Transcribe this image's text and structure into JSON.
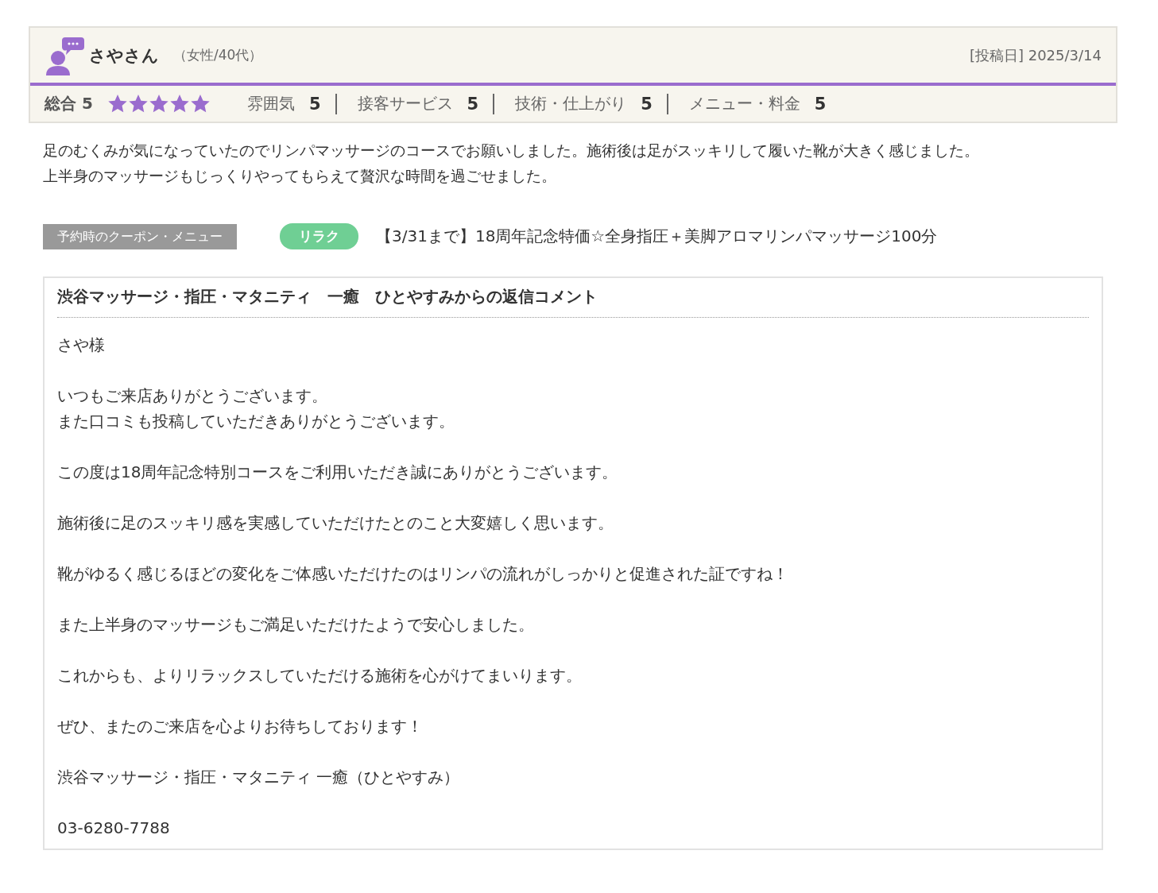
{
  "review": {
    "reviewer": "さやさん",
    "profile": "（女性/40代）",
    "posted_date": "[投稿日] 2025/3/14",
    "overall": {
      "label": "総合",
      "score": "5",
      "stars": 5
    },
    "ratings": [
      {
        "label": "雰囲気",
        "score": "5"
      },
      {
        "label": "接客サービス",
        "score": "5"
      },
      {
        "label": "技術・仕上がり",
        "score": "5"
      },
      {
        "label": "メニュー・料金",
        "score": "5"
      }
    ],
    "body": [
      "足のむくみが気になっていたのでリンパマッサージのコースでお願いしました。施術後は足がスッキリして履いた靴が大きく感じました。",
      "上半身のマッサージもじっくりやってもらえて贅沢な時間を過ごせました。"
    ],
    "coupon": {
      "label": "予約時のクーポン・メニュー",
      "tag": "リラク",
      "title": "【3/31まで】18周年記念特価☆全身指圧＋美脚アロマリンパマッサージ100分"
    },
    "reply": {
      "title": "渋谷マッサージ・指圧・マタニティ　一癒　ひとやすみからの返信コメント",
      "paragraphs": [
        "さや様",
        "いつもご来店ありがとうございます。",
        "また口コミも投稿していただきありがとうございます。",
        "この度は18周年記念特別コースをご利用いただき誠にありがとうございます。",
        "施術後に足のスッキリ感を実感していただけたとのこと大変嬉しく思います。",
        "靴がゆるく感じるほどの変化をご体感いただけたのはリンパの流れがしっかりと促進された証ですね！",
        "また上半身のマッサージもご満足いただけたようで安心しました。",
        "これからも、よりリラックスしていただける施術を心がけてまいります。",
        "ぜひ、またのご来店を心よりお待ちしております！",
        "渋谷マッサージ・指圧・マタニティ 一癒（ひとやすみ）",
        "03-6280-7788"
      ]
    }
  }
}
